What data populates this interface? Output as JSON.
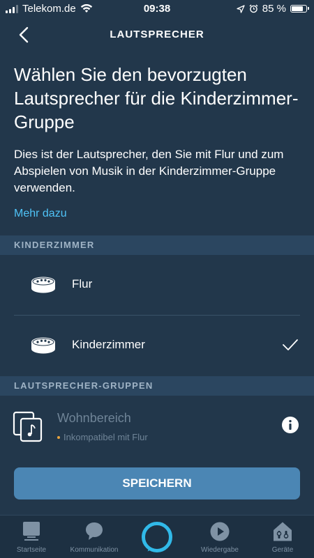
{
  "status_bar": {
    "carrier": "Telekom.de",
    "time": "09:38",
    "battery_percent": "85 %",
    "battery_level": 0.85
  },
  "nav": {
    "title": "LAUTSPRECHER"
  },
  "content": {
    "heading": "Wählen Sie den bevorzugten Lautsprecher für die Kinderzimmer-Gruppe",
    "description": "Dies ist der Lautsprecher, den Sie mit Flur und zum Abspielen von Musik in der Kinderzimmer-Gruppe verwenden.",
    "more_link": "Mehr dazu"
  },
  "sections": {
    "room": {
      "header": "KINDERZIMMER",
      "devices": [
        {
          "label": "Flur",
          "selected": false
        },
        {
          "label": "Kinderzimmer",
          "selected": true
        }
      ]
    },
    "groups": {
      "header": "LAUTSPRECHER-GRUPPEN",
      "items": [
        {
          "label": "Wohnbereich",
          "status": "Inkompatibel mit Flur"
        }
      ]
    }
  },
  "save_button": {
    "label": "SPEICHERN"
  },
  "tabbar": {
    "tabs": [
      {
        "label": "Startseite",
        "icon": "home-icon"
      },
      {
        "label": "Kommunikation",
        "icon": "chat-bubble-icon"
      },
      {
        "label": "",
        "icon": "alexa-ring-icon"
      },
      {
        "label": "Wiedergabe",
        "icon": "play-icon"
      },
      {
        "label": "Geräte",
        "icon": "devices-house-icon"
      }
    ]
  },
  "colors": {
    "background": "#22374b",
    "section_header": "#2b4660",
    "link": "#4fc3f7",
    "button": "#4b86b4",
    "alexa_accent": "#31b9e8",
    "warning_dot": "#e8a33d"
  }
}
